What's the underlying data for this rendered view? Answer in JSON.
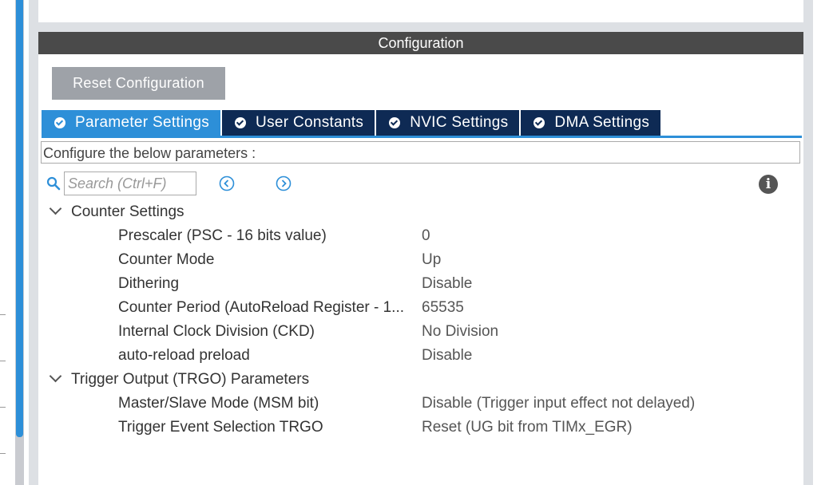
{
  "panel": {
    "title": "Configuration",
    "reset_label": "Reset Configuration"
  },
  "tabs": [
    {
      "label": "Parameter Settings",
      "active": true
    },
    {
      "label": "User Constants",
      "active": false
    },
    {
      "label": "NVIC Settings",
      "active": false
    },
    {
      "label": "DMA Settings",
      "active": false
    }
  ],
  "description": "Configure the below parameters :",
  "search": {
    "placeholder": "Search (Ctrl+F)",
    "icon": "search-icon",
    "prev_icon": "circle-chevron-left-icon",
    "next_icon": "circle-chevron-right-icon",
    "info_icon": "info-icon"
  },
  "groups": [
    {
      "label": "Counter Settings",
      "params": [
        {
          "name": "Prescaler (PSC - 16 bits value)",
          "value": "0"
        },
        {
          "name": "Counter Mode",
          "value": "Up"
        },
        {
          "name": "Dithering",
          "value": "Disable"
        },
        {
          "name": "Counter Period (AutoReload Register - 1...",
          "value": "65535"
        },
        {
          "name": "Internal Clock Division (CKD)",
          "value": "No Division"
        },
        {
          "name": "auto-reload preload",
          "value": "Disable"
        }
      ]
    },
    {
      "label": "Trigger Output (TRGO) Parameters",
      "params": [
        {
          "name": "Master/Slave Mode (MSM bit)",
          "value": "Disable (Trigger input effect not delayed)"
        },
        {
          "name": "Trigger Event Selection TRGO",
          "value": "Reset (UG bit from TIMx_EGR)"
        }
      ]
    }
  ],
  "colors": {
    "accent": "#2d8fd8",
    "tab_dark": "#0e2a54",
    "header_bar": "#4a4a4a",
    "reset_button": "#9ea2a8"
  }
}
